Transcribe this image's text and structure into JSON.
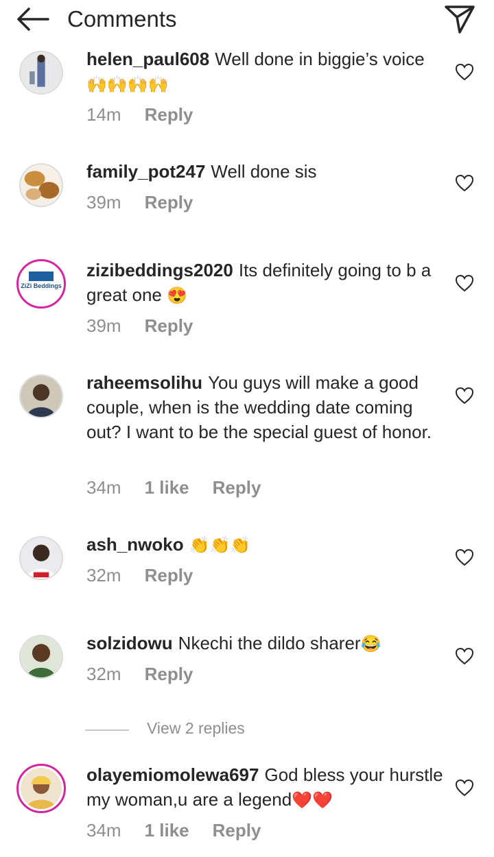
{
  "header": {
    "title": "Comments",
    "back_icon": "arrow-left-icon",
    "share_icon": "paper-plane-icon"
  },
  "comments": [
    {
      "username": "helen_paul608",
      "text": "Well done in biggie’s voice",
      "emoji": "🙌🙌🙌🙌",
      "time": "14m",
      "likes": "",
      "reply": "Reply"
    },
    {
      "username": "family_pot247",
      "text": "Well done sis",
      "emoji": "",
      "time": "39m",
      "likes": "",
      "reply": "Reply"
    },
    {
      "username": "zizibeddings2020",
      "text": "Its definitely going to b a great one",
      "emoji": "😍",
      "time": "39m",
      "likes": "",
      "reply": "Reply",
      "avatar_text": "ZiZi Beddings"
    },
    {
      "username": "raheemsolihu",
      "text": "You guys will make a good couple, when is the wedding date coming out? I want to be the special guest of honor.",
      "emoji": "",
      "time": "34m",
      "likes": "1 like",
      "reply": "Reply"
    },
    {
      "username": "ash_nwoko",
      "text": "",
      "emoji": "👏👏👏",
      "time": "32m",
      "likes": "",
      "reply": "Reply"
    },
    {
      "username": "solzidowu",
      "text": "Nkechi the dildo sharer",
      "emoji": "😂",
      "time": "32m",
      "likes": "",
      "reply": "Reply"
    },
    {
      "username": "olayemiomolewa697",
      "text": "God bless your hurstle my woman,u are a legend",
      "emoji": "❤️❤️",
      "time": "34m",
      "likes": "1 like",
      "reply": "Reply"
    }
  ],
  "view_replies": "View 2 replies",
  "colors": {
    "text": "#262626",
    "meta": "#8e8e8e",
    "story_ring": "#d6249f"
  }
}
